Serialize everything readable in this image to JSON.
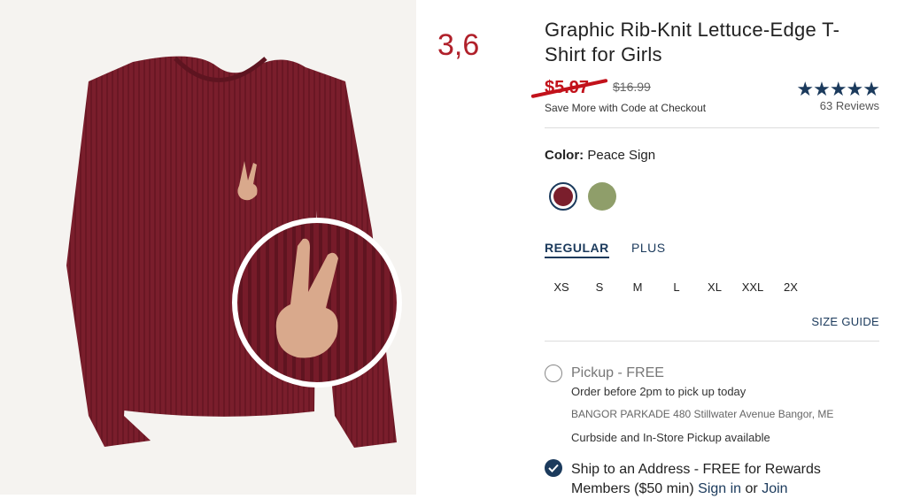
{
  "annotation": "3,6",
  "product": {
    "title": "Graphic Rib-Knit Lettuce-Edge T-Shirt for Girls",
    "sale_price": "$5.97",
    "original_price": "$16.99",
    "promo_text": "Save More with Code at Checkout",
    "rating_stars": "★★★★★",
    "reviews": "63 Reviews"
  },
  "color": {
    "label": "Color:",
    "value": "Peace Sign",
    "swatches": [
      {
        "name": "Peace Sign",
        "hex": "#7a1e2c",
        "selected": true
      },
      {
        "name": "Green",
        "hex": "#8f9e6a",
        "selected": false
      }
    ]
  },
  "fit": {
    "tabs": [
      "REGULAR",
      "PLUS"
    ],
    "active": "REGULAR"
  },
  "sizes": [
    "XS",
    "S",
    "M",
    "L",
    "XL",
    "XXL",
    "2X"
  ],
  "size_guide": "SIZE GUIDE",
  "fulfillment": {
    "pickup_label": "Pickup - FREE",
    "pickup_note": "Order before 2pm to pick up today",
    "store_name": "BANGOR PARKADE",
    "store_address": "480 Stillwater Avenue",
    "store_city": "Bangor, ME",
    "curbside": "Curbside and In-Store Pickup available",
    "ship_label": "Ship to an Address - FREE for Rewards Members ($50 min)",
    "sign_in": "Sign in",
    "or": "or",
    "join": "Join"
  },
  "colors": {
    "shirt": "#7a1e2c",
    "accent": "#1b3a5c",
    "sale": "#c2121b"
  }
}
